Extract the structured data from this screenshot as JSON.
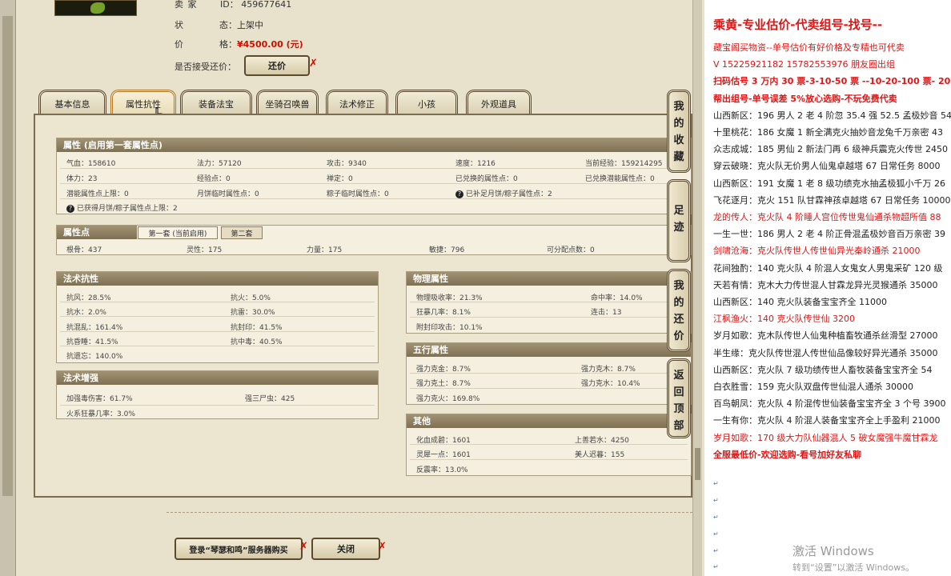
{
  "info": {
    "seller_label": "卖 家",
    "seller_key2": "ID：",
    "seller_id": "459677641",
    "status_key1": "状",
    "status_key2": "态：",
    "status_value": "上架中",
    "price_key1": "价",
    "price_key2": "格：",
    "price_value": "¥4500.00 (元)",
    "counter_offer_label": "是否接受还价：",
    "counter_offer_button": "还价"
  },
  "tabs": [
    {
      "label": "基本信息"
    },
    {
      "label": "属性抗性",
      "active": true
    },
    {
      "label": "装备法宝"
    },
    {
      "label": "坐骑召唤兽"
    },
    {
      "label": "法术修正"
    },
    {
      "label": "小孩"
    },
    {
      "label": "外观道具"
    }
  ],
  "attributes": {
    "header": "属性 (启用第一套属性点)",
    "rows": [
      [
        "气血：158610",
        "法力：57120",
        "攻击：9340",
        "速度：1216",
        "当前经验：159214295"
      ],
      [
        "体力：23",
        "经验点：0",
        "禅定：0",
        "已兑换的属性点：0",
        "已兑换潜能属性点：0"
      ],
      [
        "潜能属性点上限：0",
        "月饼临时属性点：0",
        "粽子临时属性点：0",
        "已补足月饼/粽子属性点：2"
      ]
    ],
    "extra": "已获得月饼/粽子属性点上限：2"
  },
  "attr_points": {
    "header": "属性点",
    "subtabs": [
      "第一套 (当前启用)",
      "第二套"
    ],
    "values": [
      "根骨：437",
      "灵性：175",
      "力量：175",
      "敏捷：796",
      "可分配点数：0"
    ]
  },
  "spell_resist": {
    "header": "法术抗性",
    "items": [
      "抗风：28.5%",
      "抗火：5.0%",
      "抗水：2.0%",
      "抗雷：30.0%",
      "抗混乱：161.4%",
      "抗封印：41.5%",
      "抗昏睡：41.5%",
      "抗中毒：40.5%",
      "抗遗忘：140.0%"
    ]
  },
  "spell_boost": {
    "header": "法术增强",
    "items": [
      "加强毒伤害：61.7%",
      "强三尸虫：425",
      "火系狂暴几率：3.0%"
    ]
  },
  "physical": {
    "header": "物理属性",
    "items": [
      "物理吸收率：21.3%",
      "命中率：14.0%",
      "狂暴几率：8.1%",
      "连击：13",
      "附封印攻击：10.1%"
    ]
  },
  "five_elements": {
    "header": "五行属性",
    "items": [
      "强力克金：8.7%",
      "强力克木：8.7%",
      "强力克土：8.7%",
      "强力克水：10.4%",
      "强力克火：169.8%"
    ]
  },
  "other": {
    "header": "其他",
    "items": [
      "化血成碧：1601",
      "上善若水：4250",
      "灵犀一点：1601",
      "美人迟暮：155",
      "反震率：13.0%"
    ]
  },
  "side_buttons": [
    [
      "我",
      "的",
      "收",
      "藏"
    ],
    [
      "足",
      "迹"
    ],
    [
      "我",
      "的",
      "还",
      "价"
    ],
    [
      "返",
      "回",
      "顶",
      "部"
    ]
  ],
  "bottom": {
    "buy_button": "登录“琴瑟和鸣”服务器购买",
    "close_button": "关闭"
  },
  "close_glyph": "✗",
  "help_glyph": "?",
  "para_mark": "↵",
  "notepad": {
    "title": "乘黄-专业估价-代卖组号-找号--",
    "lines": [
      {
        "text": "藏宝阁买物资--单号估价有好价格及专精也可代卖",
        "style": "red"
      },
      {
        "text": "V 15225921182   15782553976  朋友圈出组",
        "style": "red"
      },
      {
        "text": "扫码估号 3 万内 30 票-3-10-50 票  --10-20-100 票- 20 以上",
        "style": "red bold"
      },
      {
        "text": "帮出组号-单号误差 5%放心选购-不玩免费代卖",
        "style": "red bold"
      },
      {
        "text": "山西新区：196 男人 2 老 4 阶忽 35.4 强 52.5 孟极妙音 540",
        "style": ""
      },
      {
        "text": "十里桃花：186 女魔 1 新全满克火抽妙音龙兔千万亲密 43",
        "style": ""
      },
      {
        "text": "众志成城：185 男仙 2 新法门再 6 级神兵震克火传世 2450",
        "style": ""
      },
      {
        "text": "穿云破晓：克火队无价男人仙鬼卓越塔 67 日常任务 8000",
        "style": ""
      },
      {
        "text": "山西新区：191 女魔 1 老 8 级功绩克水抽孟极狐小千万 26",
        "style": ""
      },
      {
        "text": "飞花逐月：克火 151 队甘霖神孩卓越塔 67 日常任务 10000",
        "style": ""
      },
      {
        "text": "龙的传人：克火队 4 阶睡人宫位传世鬼仙通杀物超所值 88",
        "style": "red"
      },
      {
        "text": "一生一世：186 男人 2 老 4 阶正骨混孟极妙音百万亲密 39",
        "style": ""
      },
      {
        "text": "剑啸沧海：克火队传世人传世仙异光秦岭通杀 21000",
        "style": "red"
      },
      {
        "text": "花间独酌：140 克火队 4 阶混人女鬼女人男鬼采矿 120 级",
        "style": ""
      },
      {
        "text": "天若有情：克木大力传世混人甘霖龙异光灵猴通杀 35000",
        "style": ""
      },
      {
        "text": "山西新区：140 克火队装备宝宝齐全 11000",
        "style": ""
      },
      {
        "text": "江枫渔火：140 克火队传世仙 3200",
        "style": "red"
      },
      {
        "text": "岁月如歌：克木队传世人仙鬼种植畜牧通杀丝滑型 27000",
        "style": ""
      },
      {
        "text": "半生缘：克火队传世混人传世仙品像较好异光通杀 35000",
        "style": ""
      },
      {
        "text": "山西新区：克火队 7 级功绩传世人畜牧装备宝宝齐全 54",
        "style": ""
      },
      {
        "text": "白衣胜雪：159 克火队双盘传世仙混人通杀 30000",
        "style": ""
      },
      {
        "text": "百鸟朝凤：克火队 4 阶混传世仙装备宝宝齐全 3 个号 3900",
        "style": ""
      },
      {
        "text": "一生有你：克火队 4 阶混人装备宝宝齐全上手盈利 21000",
        "style": ""
      },
      {
        "text": "岁月如歌：170 级大力队仙器混人 5 破女魔强牛魔甘霖龙",
        "style": "red"
      },
      {
        "text": "全服最低价-欢迎选购-看号加好友私聊",
        "style": "red bold"
      }
    ]
  },
  "watermark": {
    "title": "激活 Windows",
    "subtitle": "转到“设置”以激活 Windows。"
  }
}
